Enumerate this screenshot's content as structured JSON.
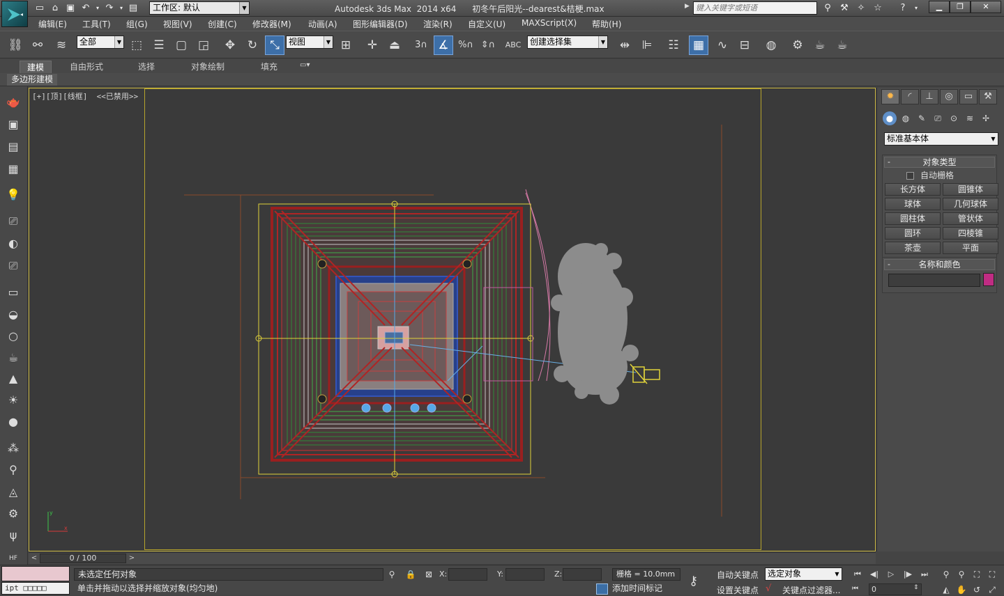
{
  "app": {
    "window_title": "Autodesk 3ds Max  2014 x64      初冬午后阳光--dearest&桔梗.max",
    "workspace_label": "工作区: 默认",
    "search_placeholder": "键入关键字或短语"
  },
  "menus": [
    "编辑(E)",
    "工具(T)",
    "组(G)",
    "视图(V)",
    "创建(C)",
    "修改器(M)",
    "动画(A)",
    "图形编辑器(D)",
    "渲染(R)",
    "自定义(U)",
    "MAXScript(X)",
    "帮助(H)"
  ],
  "toolbar": {
    "selection_filter": "全部",
    "reference_coord": "视图",
    "named_selection": "创建选择集"
  },
  "ribbon": {
    "tabs": [
      "建模",
      "自由形式",
      "选择",
      "对象绘制",
      "填充"
    ],
    "active_tab": "建模",
    "sub_label": "多边形建模"
  },
  "viewport": {
    "label": "[+][顶][线框]  <<已禁用>>"
  },
  "command_panel": {
    "category": "标准基本体",
    "object_type_title": "对象类型",
    "autogrid_label": "自动栅格",
    "buttons": [
      "长方体",
      "圆锥体",
      "球体",
      "几何球体",
      "圆柱体",
      "管状体",
      "圆环",
      "四棱锥",
      "茶壶",
      "平面"
    ],
    "name_color_title": "名称和颜色",
    "object_color": "#c02c83"
  },
  "timeslider": {
    "frame_display": "0 / 100"
  },
  "status": {
    "maxscript": "ipt □□□□□",
    "line1": "未选定任何对象",
    "line2": "单击并拖动以选择并缩放对象(均匀地)",
    "x_label": "X:",
    "y_label": "Y:",
    "z_label": "Z:",
    "grid": "栅格 = 10.0mm",
    "add_time_tag": "添加时间标记",
    "auto_key": "自动关键点",
    "set_key": "设置关键点",
    "selection_mode": "选定对象",
    "key_filters": "关键点过滤器...",
    "current_frame": "0"
  }
}
